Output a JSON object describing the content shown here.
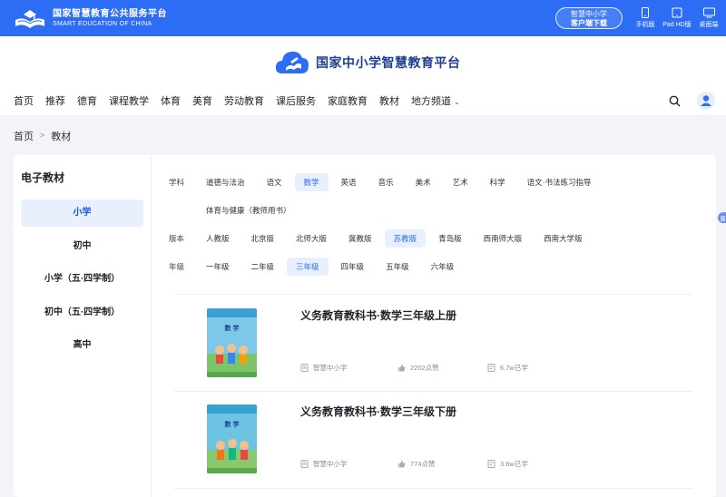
{
  "topbar": {
    "logo_cn": "国家智慧教育公共服务平台",
    "logo_en": "SMART EDUCATION OF CHINA",
    "download_line1": "智慧中小学",
    "download_line2": "客户端下载",
    "devices": [
      {
        "icon": "phone-icon",
        "label": "手机版"
      },
      {
        "icon": "tablet-icon",
        "label": "Pad HD版"
      },
      {
        "icon": "desktop-icon",
        "label": "桌面端"
      }
    ],
    "bg_color": "#2d6df6"
  },
  "brand": {
    "title": "国家中小学智慧教育平台"
  },
  "nav": {
    "items": [
      "首页",
      "推荐",
      "德育",
      "课程教学",
      "体育",
      "美育",
      "劳动教育",
      "课后服务",
      "家庭教育",
      "教材"
    ],
    "region": "地方频道"
  },
  "breadcrumb": {
    "home": "首页",
    "sep": ">",
    "current": "教材"
  },
  "sidebar": {
    "title": "电子教材",
    "items": [
      "小学",
      "初中",
      "小学（五·四学制）",
      "初中（五·四学制）",
      "高中"
    ],
    "active": "小学"
  },
  "filters": {
    "subject": {
      "label": "学科",
      "options": [
        "道德与法治",
        "语文",
        "数学",
        "英语",
        "音乐",
        "美术",
        "艺术",
        "科学",
        "语文·书法练习指导"
      ],
      "options_row2": [
        "体育与健康（教师用书）"
      ],
      "active": "数学"
    },
    "edition": {
      "label": "版本",
      "options": [
        "人教版",
        "北京版",
        "北师大版",
        "冀教版",
        "苏教版",
        "青岛版",
        "西南师大版",
        "西南大学版"
      ],
      "active": "苏教版"
    },
    "grade": {
      "label": "年级",
      "options": [
        "一年级",
        "二年级",
        "三年级",
        "四年级",
        "五年级",
        "六年级"
      ],
      "active": "三年级"
    }
  },
  "books": [
    {
      "title": "义务教育教科书·数学三年级上册",
      "publisher": "智慧中小学",
      "likes": "2202点赞",
      "learners": "6.7w已学",
      "cover_text": "数 学"
    },
    {
      "title": "义务教育教科书·数学三年级下册",
      "publisher": "智慧中小学",
      "likes": "774点赞",
      "learners": "3.6w已学",
      "cover_text": "数 学"
    }
  ],
  "colors": {
    "accent": "#2d6df6",
    "active_bg": "#e8effd",
    "brand_title": "#1f3f91"
  }
}
